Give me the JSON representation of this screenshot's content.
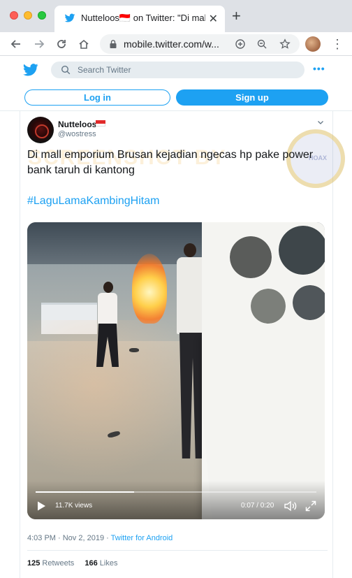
{
  "browser": {
    "tab_title": "Nutteloos🇮🇩 on Twitter: \"Di mall",
    "tab_close": "✕",
    "new_tab": "+",
    "url": "mobile.twitter.com/w..."
  },
  "header": {
    "search_placeholder": "Search Twitter",
    "more": "•••",
    "login_label": "Log in",
    "signup_label": "Sign up"
  },
  "tweet": {
    "display_name": "Nutteloos",
    "handle": "@wostress",
    "text": "Di mall emporium Brusan kejadian ngecas hp pake power bank taruh di kantong",
    "hashtag": "#LaguLamaKambingHitam",
    "timestamp": "4:03 PM · Nov 2, 2019 · ",
    "source": "Twitter for Android",
    "retweets_count": "125",
    "retweets_label": " Retweets",
    "likes_count": "166",
    "likes_label": " Likes"
  },
  "video": {
    "views": "11.7K views",
    "time": "0:07 / 0:20",
    "progress": 0.35
  },
  "watermark": {
    "text": "SCREENSHOT BY",
    "seal": "HOAX"
  },
  "colors": {
    "twitter_blue": "#1da1f2",
    "flag_red": "#e12a2a"
  },
  "icons": {
    "tab_favicon": "twitter-bird-icon",
    "back": "arrow-left-icon",
    "forward": "arrow-right-icon",
    "reload": "reload-icon",
    "home": "home-icon",
    "lock": "lock-icon",
    "add": "plus-circle-icon",
    "zoom": "zoom-icon",
    "star": "star-icon",
    "menu": "kebab-icon"
  }
}
